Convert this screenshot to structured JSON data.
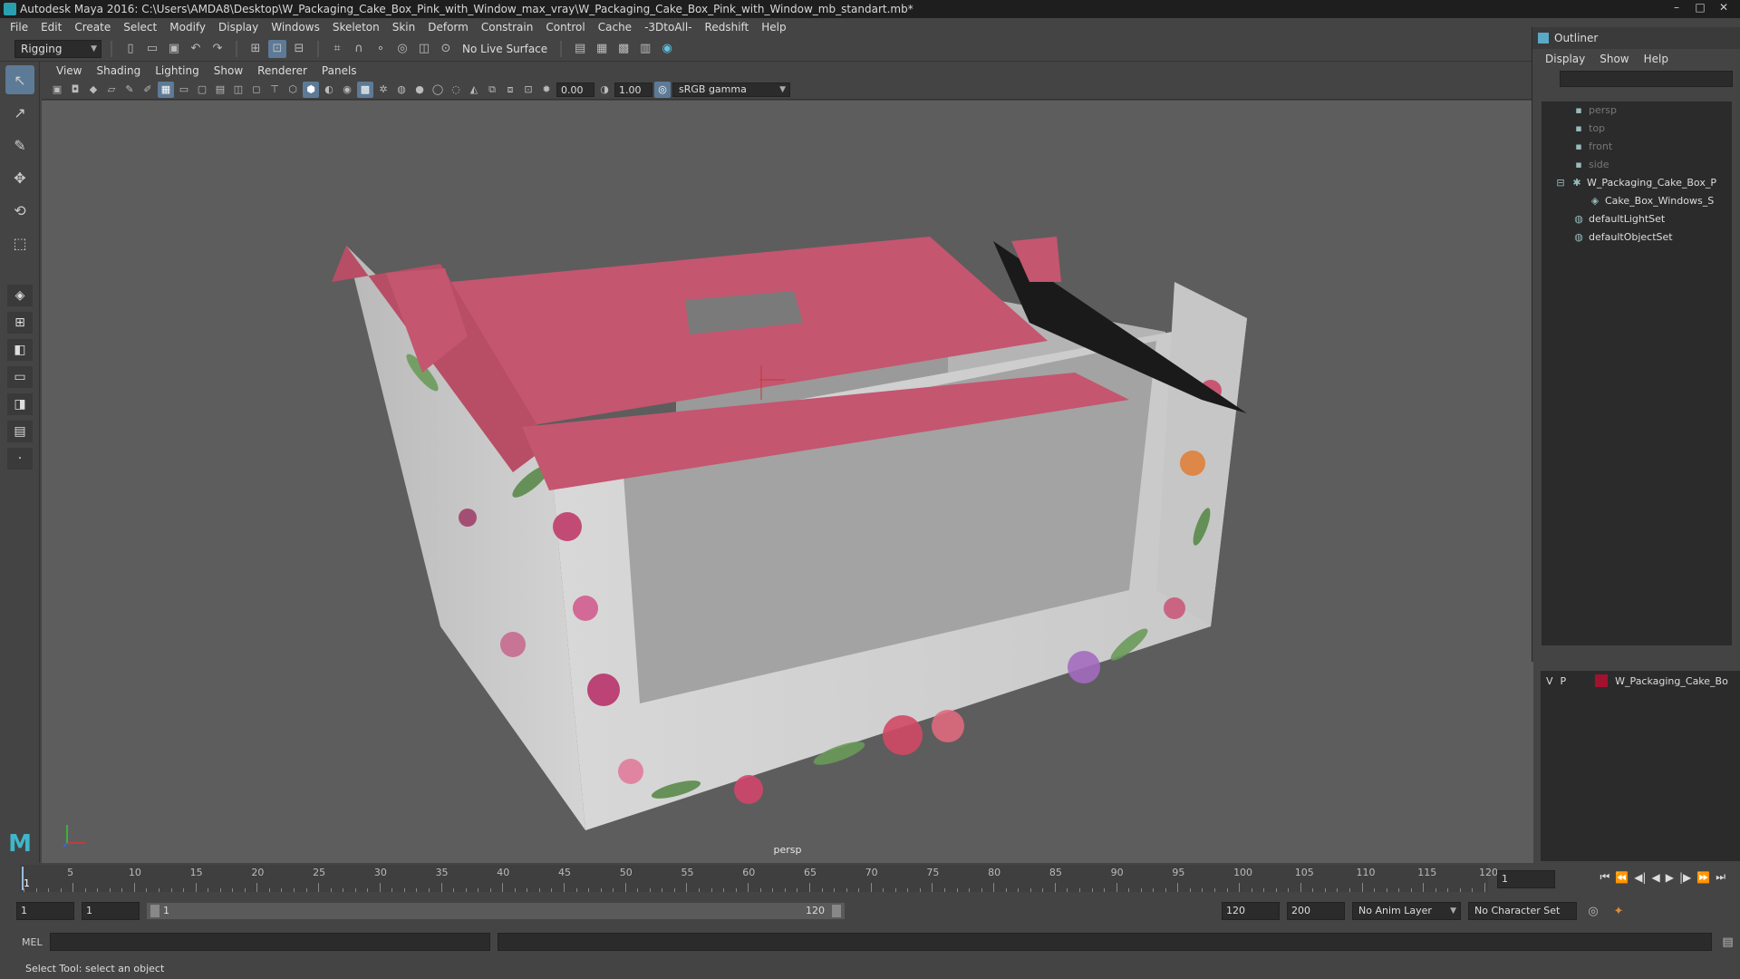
{
  "window": {
    "title": "Autodesk Maya 2016: C:\\Users\\AMDA8\\Desktop\\W_Packaging_Cake_Box_Pink_with_Window_max_vray\\W_Packaging_Cake_Box_Pink_with_Window_mb_standart.mb*",
    "minimize": "–",
    "maximize": "□",
    "close": "✕"
  },
  "menubar": {
    "items": [
      "File",
      "Edit",
      "Create",
      "Select",
      "Modify",
      "Display",
      "Windows",
      "Skeleton",
      "Skin",
      "Deform",
      "Constrain",
      "Control",
      "Cache",
      "-3DtoAll-",
      "Redshift",
      "Help"
    ]
  },
  "statusline": {
    "menuset": "Rigging",
    "live_surface": "No Live Surface"
  },
  "panel": {
    "menu": [
      "View",
      "Shading",
      "Lighting",
      "Show",
      "Renderer",
      "Panels"
    ],
    "exposure": "0.00",
    "gamma": "1.00",
    "color_space": "sRGB gamma",
    "camera_label": "persp"
  },
  "outliner": {
    "title": "Outliner",
    "menu": [
      "Display",
      "Show",
      "Help"
    ],
    "items": [
      {
        "label": "persp",
        "icon": "camera-icon",
        "dim": true
      },
      {
        "label": "top",
        "icon": "camera-icon",
        "dim": true
      },
      {
        "label": "front",
        "icon": "camera-icon",
        "dim": true
      },
      {
        "label": "side",
        "icon": "camera-icon",
        "dim": true
      },
      {
        "label": "W_Packaging_Cake_Box_P",
        "icon": "group-icon",
        "dim": false
      },
      {
        "label": "Cake_Box_Windows_S",
        "icon": "mesh-icon",
        "dim": false
      },
      {
        "label": "defaultLightSet",
        "icon": "set-icon",
        "dim": false
      },
      {
        "label": "defaultObjectSet",
        "icon": "set-icon",
        "dim": false
      }
    ]
  },
  "layers": {
    "row": {
      "v": "V",
      "p": "P",
      "name": "W_Packaging_Cake_Bo",
      "color": "#a0122e"
    }
  },
  "timeslider": {
    "labels": [
      "5",
      "10",
      "15",
      "20",
      "25",
      "30",
      "35",
      "40",
      "45",
      "50",
      "55",
      "60",
      "65",
      "70",
      "75",
      "80",
      "85",
      "90",
      "95",
      "100",
      "105",
      "110",
      "115",
      "120"
    ],
    "current_frame_label": "1",
    "current_frame_field": "1"
  },
  "range": {
    "start": "1",
    "playback_start": "1",
    "slider_start": "1",
    "slider_end": "120",
    "playback_end": "120",
    "end": "200",
    "anim_layer": "No Anim Layer",
    "character_set": "No Character Set"
  },
  "cmdline": {
    "language": "MEL"
  },
  "helpline": {
    "text": "Select Tool: select an object"
  },
  "colors": {
    "box_pink": "#c4566f",
    "box_white": "#cfcfcf",
    "viewport_bg": "#5d5d5d"
  }
}
